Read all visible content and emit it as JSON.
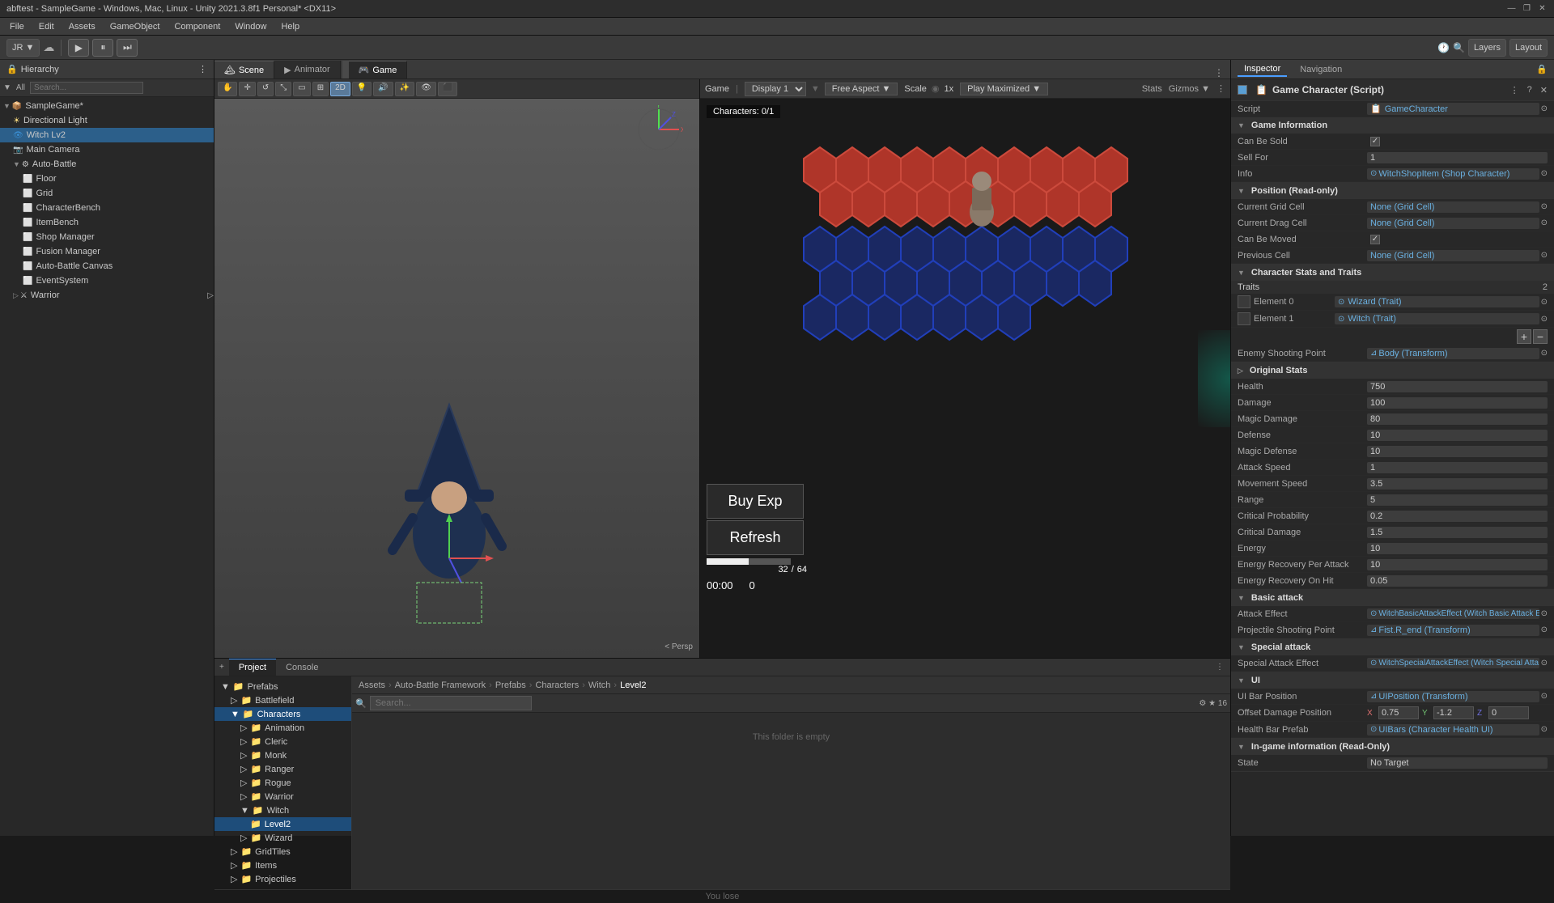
{
  "titlebar": {
    "title": "abftest - SampleGame - Windows, Mac, Linux - Unity 2021.3.8f1 Personal* <DX11>",
    "controls": [
      "—",
      "❐",
      "✕"
    ]
  },
  "menubar": {
    "items": [
      "File",
      "Edit",
      "Assets",
      "GameObject",
      "Component",
      "Window",
      "Help"
    ]
  },
  "toolbar": {
    "account": "JR ▼",
    "cloud": "☁",
    "play": "▶",
    "pause": "⏸",
    "step": "⏭",
    "layers": "Layers",
    "layout": "Layout"
  },
  "hierarchy": {
    "title": "Hierarchy",
    "all_label": "All",
    "items": [
      {
        "label": "SampleGame*",
        "indent": 0,
        "icon": "▷",
        "type": "root"
      },
      {
        "label": "Directional Light",
        "indent": 1,
        "icon": "💡",
        "type": "light"
      },
      {
        "label": "Witch Lv2",
        "indent": 1,
        "icon": "👁",
        "type": "object",
        "selected": true
      },
      {
        "label": "Main Camera",
        "indent": 1,
        "icon": "📷",
        "type": "camera"
      },
      {
        "label": "Auto-Battle",
        "indent": 1,
        "icon": "▷",
        "type": "group"
      },
      {
        "label": "Floor",
        "indent": 2,
        "icon": "⬜",
        "type": "object"
      },
      {
        "label": "Grid",
        "indent": 2,
        "icon": "⬜",
        "type": "object"
      },
      {
        "label": "CharacterBench",
        "indent": 2,
        "icon": "⬜",
        "type": "object"
      },
      {
        "label": "ItemBench",
        "indent": 2,
        "icon": "⬜",
        "type": "object"
      },
      {
        "label": "Shop Manager",
        "indent": 2,
        "icon": "⬜",
        "type": "object"
      },
      {
        "label": "Fusion Manager",
        "indent": 2,
        "icon": "⬜",
        "type": "object"
      },
      {
        "label": "Auto-Battle Canvas",
        "indent": 2,
        "icon": "⬜",
        "type": "object"
      },
      {
        "label": "EventSystem",
        "indent": 2,
        "icon": "⬜",
        "type": "object"
      },
      {
        "label": "Warrior",
        "indent": 1,
        "icon": "▷",
        "type": "group"
      }
    ]
  },
  "scene": {
    "title": "Scene",
    "persp": "< Persp",
    "buttons": [
      "hand",
      "move",
      "rotate",
      "scale",
      "rect",
      "transform",
      "2D",
      "light",
      "audio",
      "fx",
      "scene-view"
    ],
    "gizmo_label": "< Persp"
  },
  "animator": {
    "title": "Animator"
  },
  "game": {
    "title": "Game",
    "display": "Display 1",
    "aspect": "Free Aspect",
    "scale_label": "Scale",
    "scale_value": "1x",
    "play_mode": "Play Maximized",
    "characters_label": "Characters: 0/1",
    "buy_exp": "Buy Exp",
    "refresh": "Refresh",
    "progress_current": "32",
    "progress_max": "64",
    "timer": "00:00",
    "score": "0"
  },
  "bottom": {
    "tabs": [
      "Project",
      "Console"
    ],
    "active_tab": "Project",
    "breadcrumb": [
      "Assets",
      "Auto-Battle Framework",
      "Prefabs",
      "Characters",
      "Witch",
      "Level2"
    ],
    "empty_message": "This folder is empty",
    "you_lose": "You lose",
    "tree": [
      {
        "label": "Prefabs",
        "indent": 0,
        "type": "folder"
      },
      {
        "label": "Battlefield",
        "indent": 1,
        "type": "folder"
      },
      {
        "label": "Characters",
        "indent": 1,
        "type": "folder",
        "selected": true
      },
      {
        "label": "Animation",
        "indent": 2,
        "type": "folder"
      },
      {
        "label": "Cleric",
        "indent": 2,
        "type": "folder"
      },
      {
        "label": "Monk",
        "indent": 2,
        "type": "folder"
      },
      {
        "label": "Ranger",
        "indent": 2,
        "type": "folder"
      },
      {
        "label": "Rogue",
        "indent": 2,
        "type": "folder"
      },
      {
        "label": "Warrior",
        "indent": 2,
        "type": "folder"
      },
      {
        "label": "Witch",
        "indent": 2,
        "type": "folder"
      },
      {
        "label": "Level2",
        "indent": 3,
        "type": "folder",
        "selected": true
      },
      {
        "label": "Wizard",
        "indent": 2,
        "type": "folder"
      },
      {
        "label": "GridTiles",
        "indent": 1,
        "type": "folder"
      },
      {
        "label": "Items",
        "indent": 1,
        "type": "folder"
      },
      {
        "label": "Projectiles",
        "indent": 1,
        "type": "folder"
      }
    ]
  },
  "inspector": {
    "title": "Inspector",
    "nav_tab": "Navigation",
    "component_name": "Game Character (Script)",
    "script_label": "Script",
    "script_value": "GameCharacter",
    "sections": {
      "game_information": {
        "title": "Game Information",
        "can_be_sold_label": "Can Be Sold",
        "can_be_sold_value": "✓",
        "sell_for_label": "Sell For",
        "sell_for_value": "1",
        "info_label": "Info",
        "info_value": "WitchShopItem (Shop Character)"
      },
      "position": {
        "title": "Position (Read-only)",
        "current_grid_label": "Current Grid Cell",
        "current_grid_value": "None (Grid Cell)",
        "current_drag_label": "Current Drag Cell",
        "current_drag_value": "None (Grid Cell)",
        "can_be_moved_label": "Can Be Moved",
        "can_be_moved_value": "✓",
        "previous_cell_label": "Previous Cell",
        "previous_cell_value": "None (Grid Cell)"
      },
      "character_stats": {
        "title": "Character Stats and Traits",
        "traits_label": "Traits",
        "traits_count": "2",
        "element0_label": "Element 0",
        "element0_value": "Wizard (Trait)",
        "element1_label": "Element 1",
        "element1_value": "Witch (Trait)",
        "enemy_shooting_label": "Enemy Shooting Point",
        "enemy_shooting_value": "Body (Transform)"
      },
      "original_stats": {
        "title": "Original Stats",
        "stats": [
          {
            "label": "Health",
            "value": "750"
          },
          {
            "label": "Damage",
            "value": "100"
          },
          {
            "label": "Magic Damage",
            "value": "80"
          },
          {
            "label": "Defense",
            "value": "10"
          },
          {
            "label": "Magic Defense",
            "value": "10"
          },
          {
            "label": "Attack Speed",
            "value": "1"
          },
          {
            "label": "Movement Speed",
            "value": "3.5"
          },
          {
            "label": "Range",
            "value": "5"
          },
          {
            "label": "Critical Probability",
            "value": "0.2"
          },
          {
            "label": "Critical Damage",
            "value": "1.5"
          },
          {
            "label": "Energy",
            "value": "10"
          },
          {
            "label": "Energy Recovery Per Attack",
            "value": "10"
          },
          {
            "label": "Energy Recovery On Hit",
            "value": "0.05"
          }
        ]
      },
      "basic_attack": {
        "title": "Basic attack",
        "attack_effect_label": "Attack Effect",
        "attack_effect_value": "WitchBasicAttackEffect (Witch Basic Attack E...",
        "projectile_label": "Projectile Shooting Point",
        "projectile_value": "Fist.R_end (Transform)"
      },
      "special_attack": {
        "title": "Special attack",
        "special_effect_label": "Special Attack Effect",
        "special_effect_value": "WitchSpecialAttackEffect (Witch Special Atta..."
      },
      "ui": {
        "title": "UI",
        "ui_bar_label": "UI Bar Position",
        "ui_bar_value": "UIPosition (Transform)",
        "offset_label": "Offset Damage Position",
        "offset_x": "0.75",
        "offset_y": "-1.2",
        "offset_z": "0",
        "health_bar_label": "Health Bar Prefab",
        "health_bar_value": "UIBars (Character Health UI)"
      },
      "ingame_info": {
        "title": "In-game information (Read-Only)",
        "state_label": "State",
        "state_value": "No Target"
      }
    }
  }
}
